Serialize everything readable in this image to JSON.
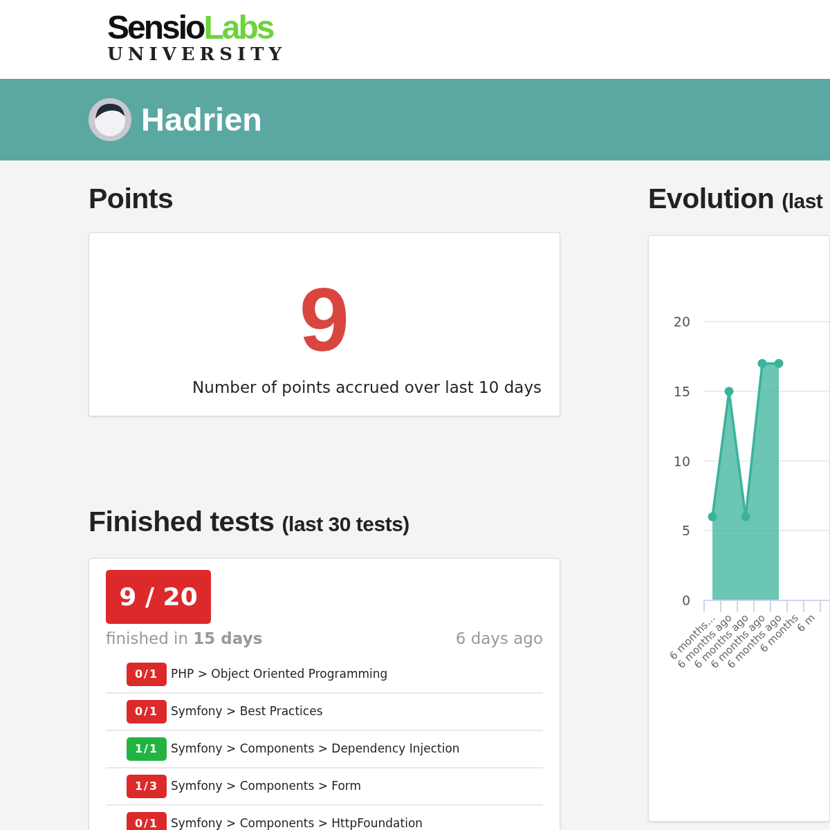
{
  "logo": {
    "brand": "Sensio",
    "brand_accent": "Labs",
    "subtitle": "UNIVERSITY"
  },
  "user": {
    "name": "Hadrien"
  },
  "points": {
    "title": "Points",
    "value": "9",
    "caption": "Number of points accrued over last 10 days"
  },
  "finished_tests": {
    "title": "Finished tests",
    "title_suffix": "(last 30 tests)",
    "score": "9 / 20",
    "passed": false,
    "duration": "finished in **15 days**",
    "when": "6 days ago",
    "items": [
      {
        "score": "0/1",
        "passed": false,
        "label": "PHP > Object Oriented Programming"
      },
      {
        "score": "0/1",
        "passed": false,
        "label": "Symfony > Best Practices"
      },
      {
        "score": "1/1",
        "passed": true,
        "label": "Symfony > Components > Dependency Injection"
      },
      {
        "score": "1/3",
        "passed": false,
        "label": "Symfony > Components > Form"
      },
      {
        "score": "0/1",
        "passed": false,
        "label": "Symfony > Components > HttpFoundation"
      }
    ]
  },
  "evolution": {
    "title": "Evolution",
    "title_suffix": "(last",
    "chart_data": {
      "type": "area",
      "categories": [
        "6 months…",
        "6 months ago",
        "6 months ago",
        "6 months ago",
        "6 months ago",
        "6 months",
        "6 m"
      ],
      "values": [
        6,
        15,
        6,
        17,
        17,
        null,
        null
      ],
      "ylim": [
        0,
        20
      ],
      "yticks": [
        0,
        5,
        10,
        15,
        20
      ],
      "grid": true,
      "color": "#3bb39b"
    }
  }
}
